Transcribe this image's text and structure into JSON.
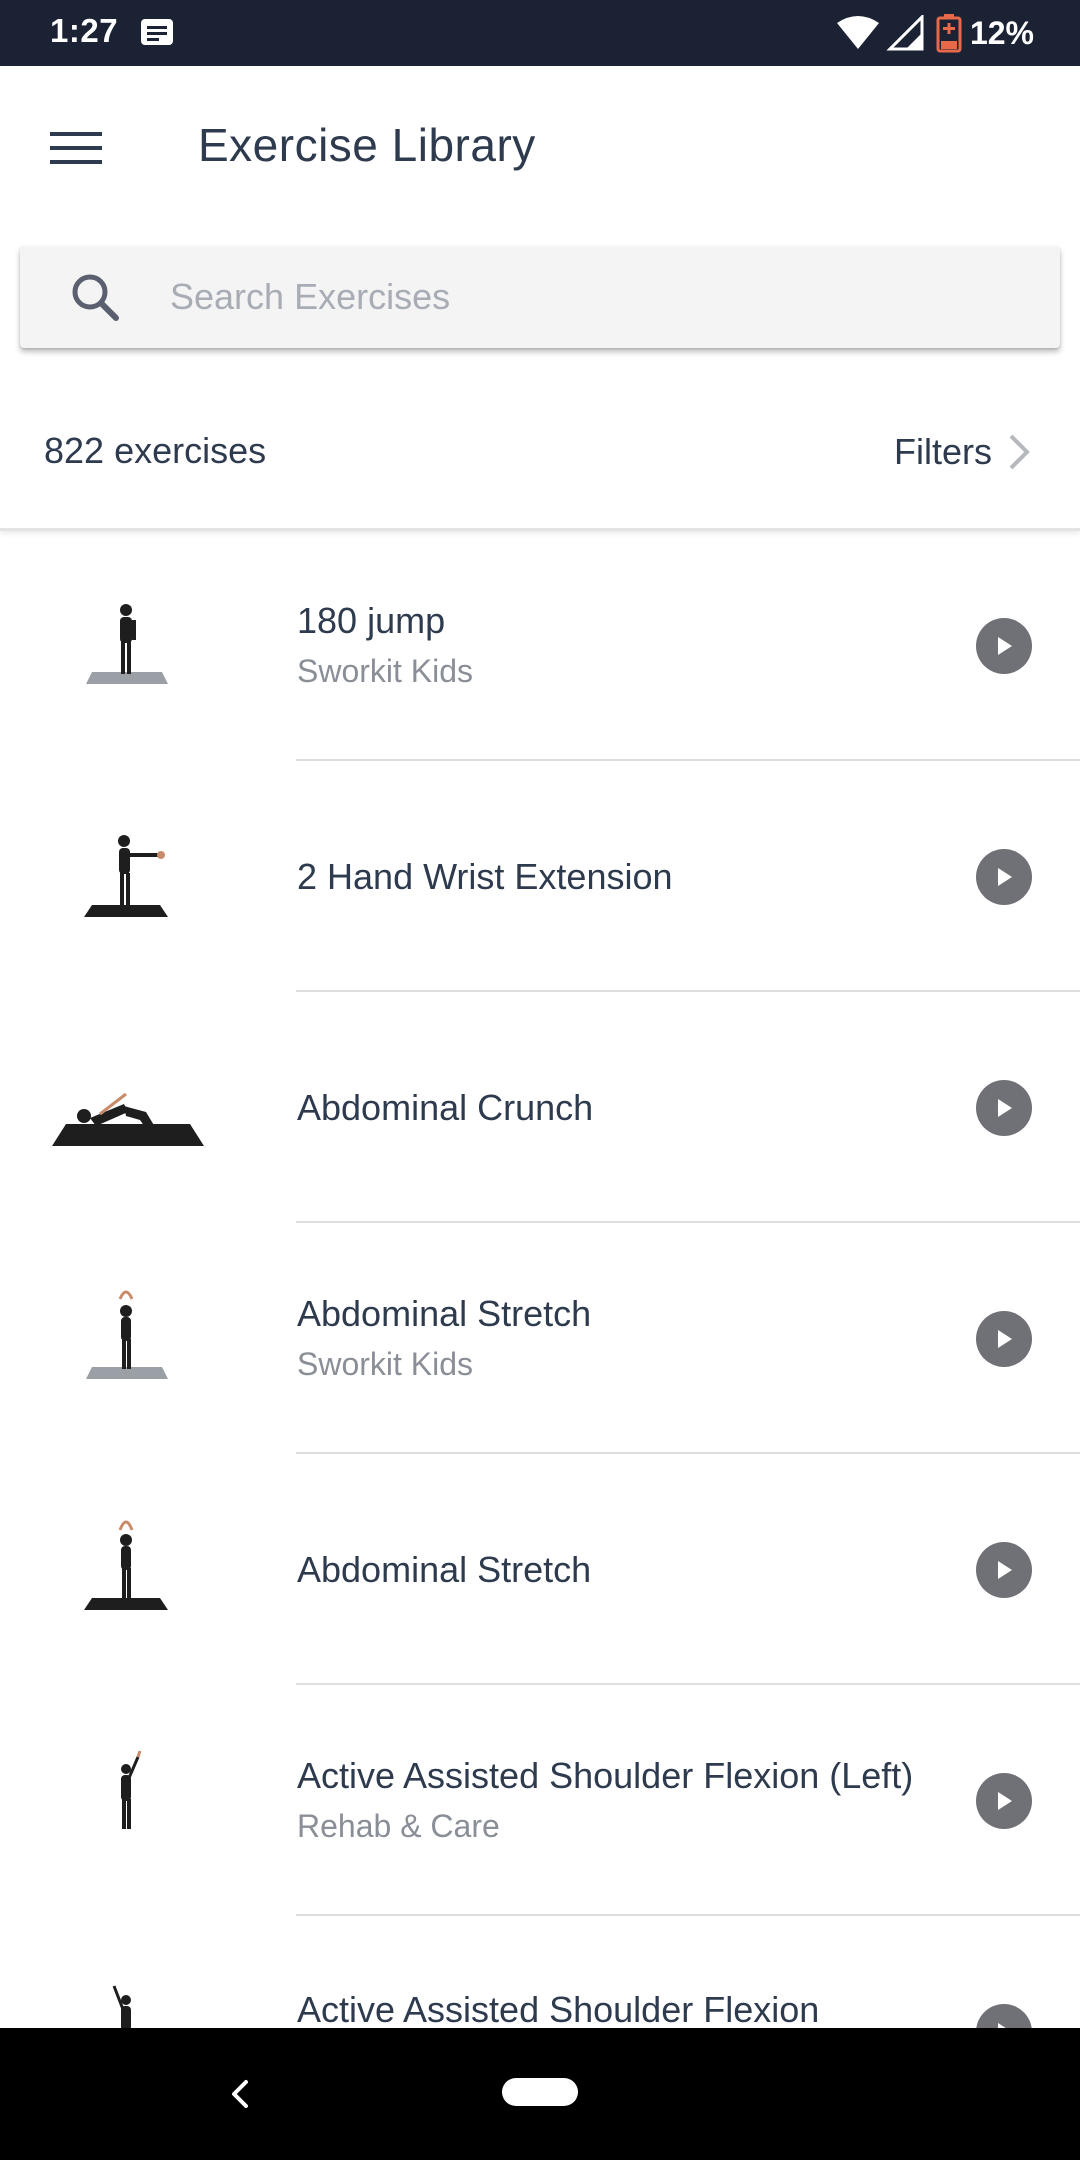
{
  "status_bar": {
    "time": "1:27",
    "battery_percent": "12%",
    "icons": [
      "message-icon",
      "wifi-icon",
      "cell-signal-icon",
      "battery-icon"
    ]
  },
  "app_bar": {
    "title": "Exercise Library",
    "menu_icon": "hamburger-menu-icon"
  },
  "search": {
    "placeholder": "Search Exercises",
    "value": ""
  },
  "summary": {
    "count_label": "822 exercises",
    "filters_label": "Filters"
  },
  "exercises": [
    {
      "name": "180 jump",
      "subtitle": "Sworkit Kids",
      "thumbnail": "standing-figure-gray-mat"
    },
    {
      "name": "2 Hand Wrist Extension",
      "subtitle": "",
      "thumbnail": "standing-arms-forward-black-mat"
    },
    {
      "name": "Abdominal Crunch",
      "subtitle": "",
      "thumbnail": "lying-crunch-black-mat"
    },
    {
      "name": "Abdominal Stretch",
      "subtitle": "Sworkit Kids",
      "thumbnail": "standing-arms-up-gray-mat"
    },
    {
      "name": "Abdominal Stretch",
      "subtitle": "",
      "thumbnail": "standing-arms-up-black-mat"
    },
    {
      "name": "Active Assisted Shoulder Flexion (Left)",
      "subtitle": "Rehab & Care",
      "thumbnail": "standing-side-stick"
    },
    {
      "name": "Active Assisted Shoulder Flexion (Right)",
      "subtitle": "",
      "thumbnail": "standing-side-stick"
    }
  ],
  "colors": {
    "status_bar": "#1b2233",
    "text_primary": "#2e3a4d",
    "text_secondary": "#8a8f97",
    "play_button": "#6f7176",
    "nav_bar": "#000000"
  }
}
